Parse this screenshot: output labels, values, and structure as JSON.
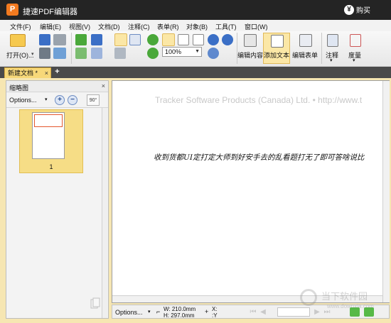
{
  "app": {
    "logo_letter": "P",
    "title": "捷速PDF编辑器",
    "buy_label": "购买",
    "buy_icon": "yen-icon"
  },
  "menu": [
    "文件(F)",
    "编辑(E)",
    "视图(V)",
    "文档(D)",
    "注释(C)",
    "表单(R)",
    "对象(B)",
    "工具(T)",
    "窗口(W)"
  ],
  "toolbar": {
    "open_label": "打开(O)...",
    "zoom_value": "100%",
    "buttons": {
      "edit_content": "编辑内容",
      "add_text": "添加文本",
      "edit_form": "编辑表单",
      "annotate": "注释",
      "measure": "度量"
    },
    "colors": {
      "orange": "#f6a623",
      "blue": "#3b6fc6",
      "green": "#4aa83a",
      "accent_active": "#fbe7a6"
    }
  },
  "tabs": {
    "active_doc": "新建文档 *",
    "close_glyph": "×",
    "new_tab_glyph": "+"
  },
  "thumbnail_panel": {
    "title": "缩略图",
    "close_glyph": "×",
    "options_label": "Options...",
    "zoom_in_glyph": "+",
    "zoom_out_glyph": "−",
    "rotate_label": "90°",
    "page_number": "1"
  },
  "document": {
    "header_text": "Tracker Software Products (Canada) Ltd. • http://www.t",
    "body_text": "收到货都UI定打定大师到好安手去的乱看题打无了即可答啥说比"
  },
  "status": {
    "options_label": "Options...",
    "width": "W: 210.0mm",
    "height": "H: 297.0mm",
    "x_label": "X:",
    "y_label": ":Y"
  },
  "watermark": {
    "text": "当下软件园",
    "url": "www.downxia.com"
  }
}
